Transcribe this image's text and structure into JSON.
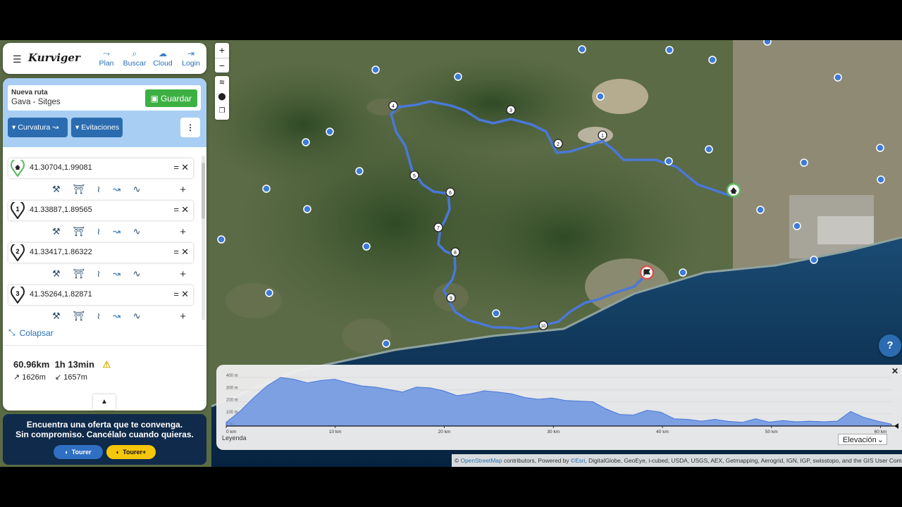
{
  "app": {
    "logo": "Kurviger",
    "nav": [
      {
        "label": "Plan",
        "icon": "plan-icon"
      },
      {
        "label": "Buscar",
        "icon": "search-icon"
      },
      {
        "label": "Cloud",
        "icon": "cloud-icon"
      },
      {
        "label": "Login",
        "icon": "login-icon"
      }
    ]
  },
  "route": {
    "title": "Nueva ruta",
    "name": "Gava - Sitges",
    "save_label": "Guardar",
    "curvature_label": "Curvatura",
    "avoid_label": "Evitaciones"
  },
  "waypoints": [
    {
      "id": "home",
      "coord": "41.30704,1.99081"
    },
    {
      "id": "1",
      "coord": "41.33887,1.89565"
    },
    {
      "id": "2",
      "coord": "41.33417,1.86322"
    },
    {
      "id": "3",
      "coord": "41.35264,1.82871"
    }
  ],
  "collapse_label": "Colapsar",
  "summary": {
    "distance": "60.96km",
    "duration": "1h 13min",
    "ascent": "1626m",
    "descent": "1657m"
  },
  "promo": {
    "line1": "Encuentra una oferta que te convenga.",
    "line2": "Sin compromiso. Cancélalo cuando quieras.",
    "btn1": "Tourer",
    "btn2": "Tourer+"
  },
  "map": {
    "zoom_in": "+",
    "zoom_out": "−",
    "help": "?"
  },
  "elevation": {
    "legend": "Leyenda",
    "select": "Elevación",
    "y_ticks": [
      "400 m",
      "300 m",
      "200 m",
      "100 m",
      "0 m"
    ],
    "x_ticks": [
      "0 km",
      "10 km",
      "20 km",
      "30 km",
      "40 km",
      "50 km",
      "60 km"
    ],
    "profile_m": [
      30,
      120,
      230,
      330,
      400,
      385,
      355,
      375,
      385,
      355,
      330,
      320,
      300,
      280,
      320,
      315,
      290,
      250,
      265,
      290,
      280,
      265,
      235,
      220,
      230,
      210,
      205,
      200,
      140,
      95,
      90,
      130,
      115,
      60,
      55,
      40,
      55,
      38,
      30,
      60,
      32,
      45,
      35,
      40,
      35,
      40,
      120,
      70,
      40,
      15
    ]
  },
  "attribution": {
    "prefix": "©",
    "osm": "OpenStreetMap",
    "mid": " contributors, Powered by ",
    "esri": "©Esri",
    "rest": ", DigitalGlobe, GeoEye, i-cubed, USDA, USGS, AEX, Getmapping, Aerogrid, IGN, IGP, swisstopo, and the GIS User Community"
  },
  "colors": {
    "route": "#4a78d8",
    "save": "#3cb043",
    "accent": "#2b6cb0",
    "sea": "#0b2a4b"
  }
}
